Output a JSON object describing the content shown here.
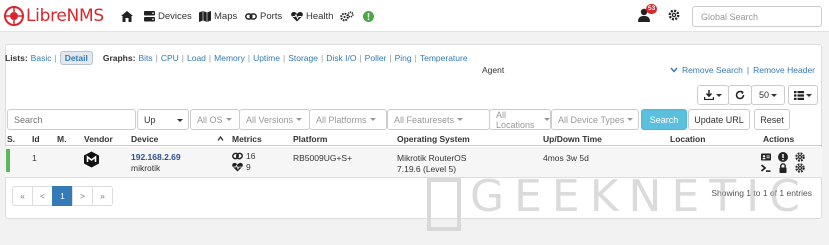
{
  "nav": {
    "brand": "LibreNMS",
    "items": [
      "Devices",
      "Maps",
      "Ports",
      "Health"
    ],
    "notification_count": "53",
    "search_placeholder": "Global Search",
    "icons": [
      "home-icon",
      "server-icon",
      "map-icon",
      "link-icon",
      "heartbeat-icon",
      "cogs-icon",
      "status-circle-icon",
      "user-icon",
      "gear-icon"
    ]
  },
  "filters": {
    "lists_label": "Lists:",
    "lists": [
      "Basic",
      "Detail"
    ],
    "graphs_label": "Graphs:",
    "graphs": [
      "Bits",
      "CPU",
      "Load",
      "Memory",
      "Uptime",
      "Storage",
      "Disk I/O",
      "Poller",
      "Ping",
      "Temperature"
    ],
    "agent": "Agent",
    "remove_search": "Remove Search",
    "remove_header": "Remove Header"
  },
  "toolbar": {
    "page_size": "50"
  },
  "search_row": {
    "search_placeholder": "Search",
    "state": "Up",
    "os": "All OS",
    "versions": "All Versions",
    "platforms": "All Platforms",
    "featuresets": "All Featuresets",
    "locations": "All Locations",
    "device_types": "All Device Types",
    "search_btn": "Search",
    "update_url": "Update URL",
    "reset": "Reset"
  },
  "table": {
    "headers": [
      "S.",
      "Id",
      "M.",
      "Vendor",
      "Device",
      "Metrics",
      "Platform",
      "Operating System",
      "Up/Down Time",
      "Location",
      "Actions"
    ],
    "rows": [
      {
        "id": "1",
        "device_ip": "192.168.2.69",
        "device_name": "mikrotik",
        "metric_ports": "16",
        "metric_sensors": "9",
        "platform": "RB5009UG+S+",
        "os": "Mikrotik RouterOS",
        "os_version": "7.19.6 (Level 5)",
        "uptime": "4mos 3w 5d",
        "location": "",
        "status_color": "#5cb85c"
      }
    ]
  },
  "pagination": {
    "pages": [
      "«",
      "<",
      "1",
      ">",
      "»"
    ],
    "active": "1",
    "showing": "Showing 1 to 1 of 1 entries"
  },
  "watermark": "GEEKNETIC",
  "colors": {
    "brand": "#d9262c",
    "link": "#337ab7",
    "search_button": "#5bc0de",
    "status_up": "#5cb85c"
  }
}
